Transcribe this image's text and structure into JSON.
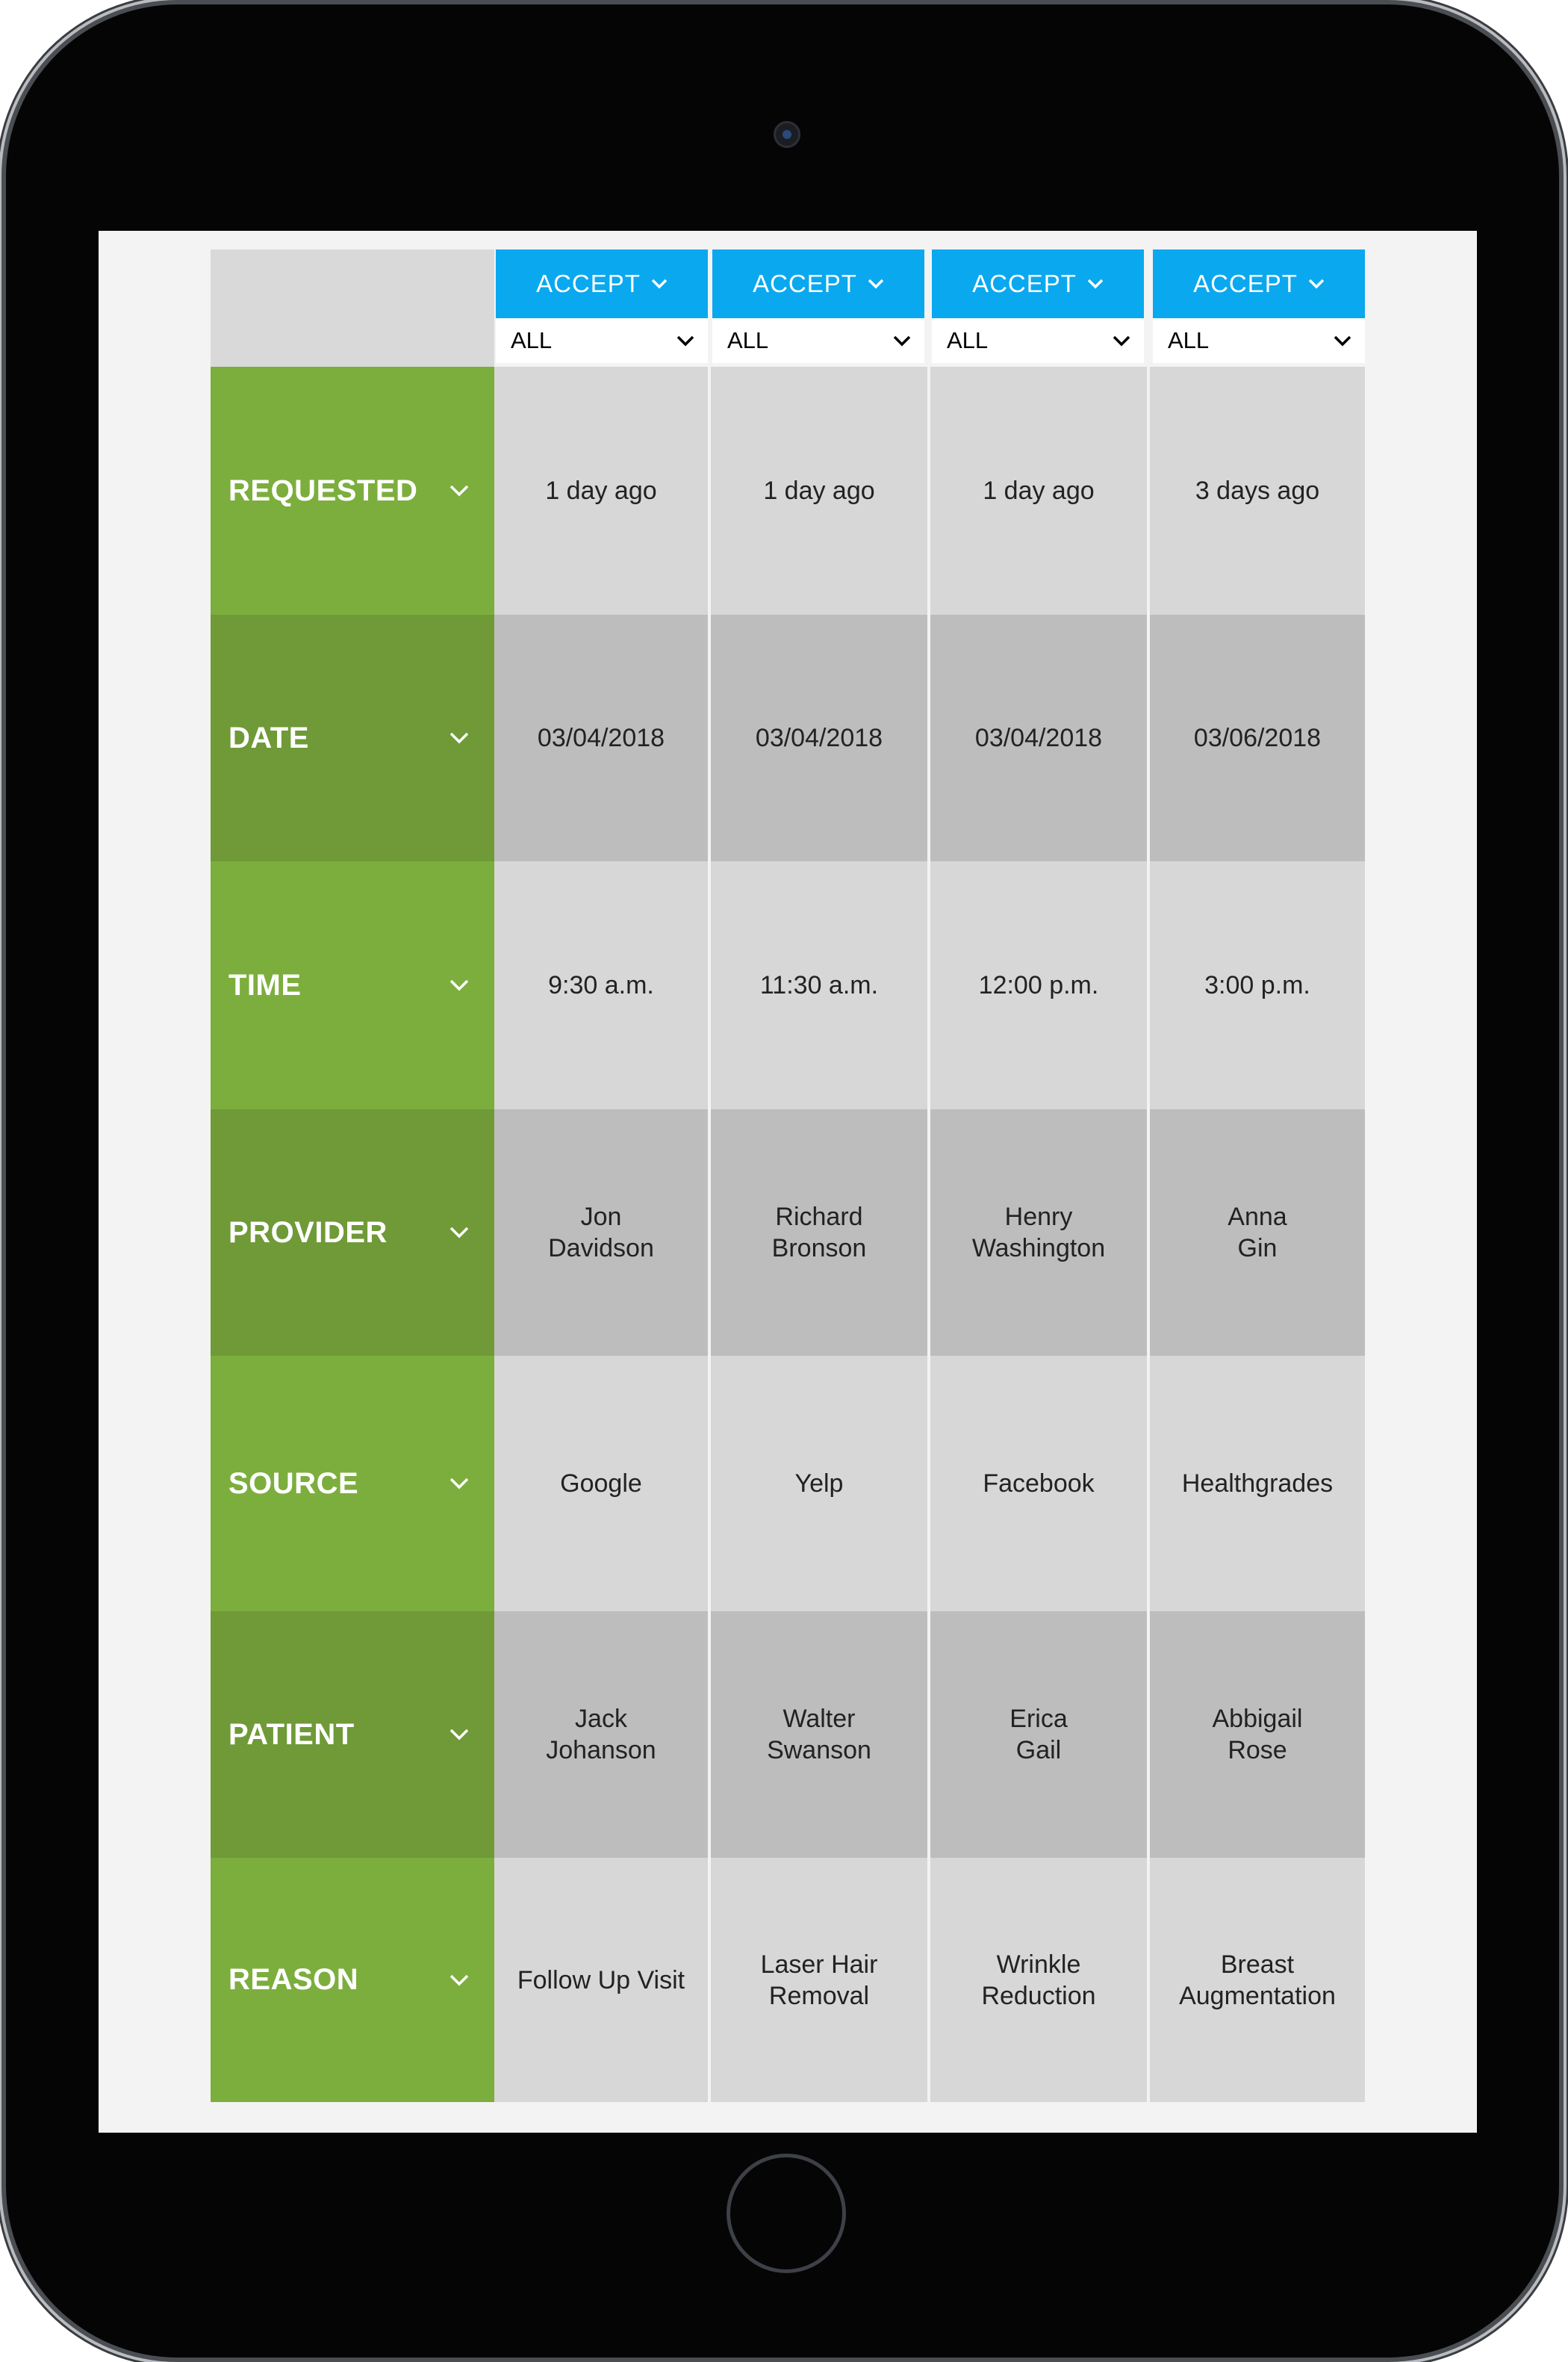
{
  "columns": [
    {
      "action_label": "ACCEPT",
      "filter_value": "ALL"
    },
    {
      "action_label": "ACCEPT",
      "filter_value": "ALL"
    },
    {
      "action_label": "ACCEPT",
      "filter_value": "ALL"
    },
    {
      "action_label": "ACCEPT",
      "filter_value": "ALL"
    }
  ],
  "rows": [
    {
      "key": "requested",
      "label": "REQUESTED",
      "values": [
        [
          "1 day ago"
        ],
        [
          "1 day ago"
        ],
        [
          "1 day ago"
        ],
        [
          "3 days ago"
        ]
      ]
    },
    {
      "key": "date",
      "label": "DATE",
      "values": [
        [
          "03/04/2018"
        ],
        [
          "03/04/2018"
        ],
        [
          "03/04/2018"
        ],
        [
          "03/06/2018"
        ]
      ]
    },
    {
      "key": "time",
      "label": "TIME",
      "values": [
        [
          "9:30 a.m."
        ],
        [
          "11:30 a.m."
        ],
        [
          "12:00 p.m."
        ],
        [
          "3:00 p.m."
        ]
      ]
    },
    {
      "key": "provider",
      "label": "PROVIDER",
      "values": [
        [
          "Jon",
          "Davidson"
        ],
        [
          "Richard",
          "Bronson"
        ],
        [
          "Henry",
          "Washington"
        ],
        [
          "Anna",
          "Gin"
        ]
      ]
    },
    {
      "key": "source",
      "label": "SOURCE",
      "values": [
        [
          "Google"
        ],
        [
          "Yelp"
        ],
        [
          "Facebook"
        ],
        [
          "Healthgrades"
        ]
      ]
    },
    {
      "key": "patient",
      "label": "PATIENT",
      "values": [
        [
          "Jack",
          "Johanson"
        ],
        [
          "Walter",
          "Swanson"
        ],
        [
          "Erica",
          "Gail"
        ],
        [
          "Abbigail",
          "Rose"
        ]
      ]
    },
    {
      "key": "reason",
      "label": "REASON",
      "values": [
        [
          "Follow Up Visit"
        ],
        [
          "Laser Hair",
          "Removal"
        ],
        [
          "Wrinkle",
          "Reduction"
        ],
        [
          "Breast",
          "Augmentation"
        ]
      ]
    }
  ],
  "colors": {
    "accent_blue": "#0aa8ef",
    "label_green_light": "#7cae3d",
    "label_green_dark": "#6f9a37",
    "cell_light": "#d7d7d7",
    "cell_dark": "#bebdbd"
  },
  "icons": {
    "accept_dropdown": "chevron-down-icon",
    "filter_dropdown": "chevron-down-icon",
    "row_expand": "chevron-down-icon"
  }
}
